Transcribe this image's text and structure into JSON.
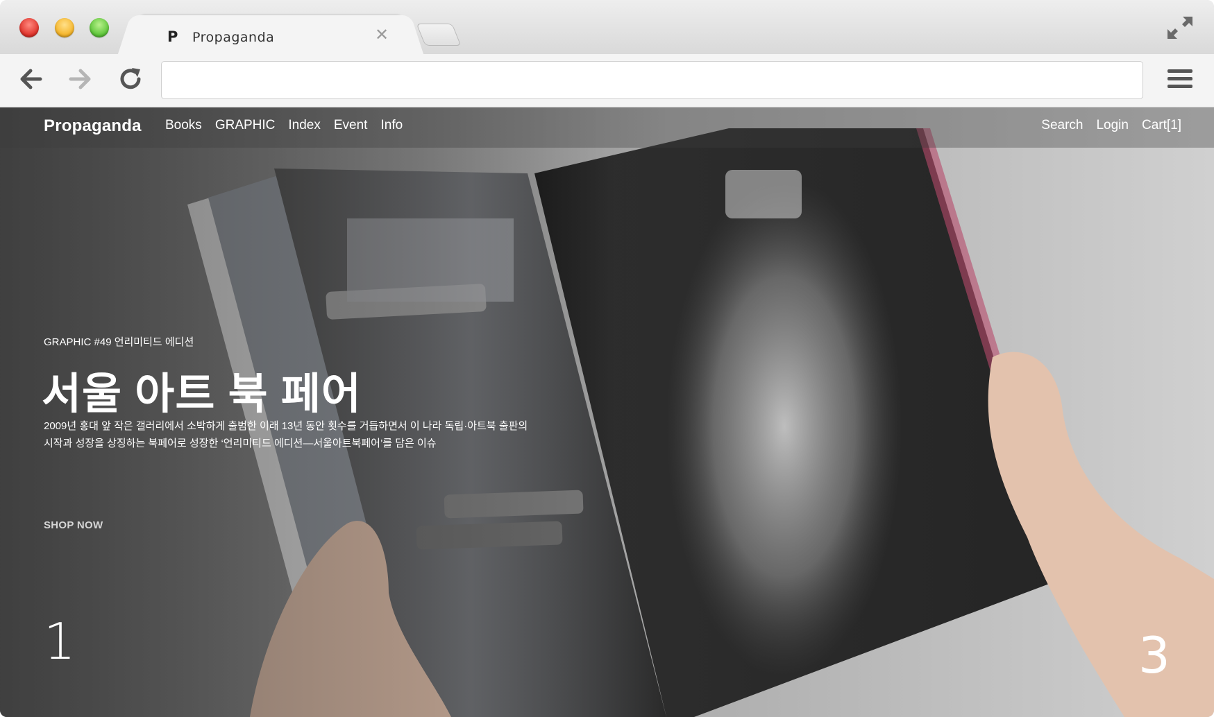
{
  "browser": {
    "tab": {
      "favicon": "P",
      "title": "Propaganda",
      "close": "✕"
    },
    "url": "",
    "icons": [
      "back-arrow-icon",
      "forward-arrow-icon",
      "reload-icon",
      "hamburger-menu-icon",
      "fullscreen-icon",
      "close-icon"
    ]
  },
  "site": {
    "logo": "Propaganda",
    "nav": [
      "Books",
      "GRAPHIC",
      "Index",
      "Event",
      "Info"
    ],
    "utility": [
      "Search",
      "Login",
      "Cart[1]"
    ]
  },
  "hero": {
    "kicker": "GRAPHIC #49 언리미티드 에디션",
    "title": "서울 아트 북 페어",
    "description_line1": "2009년 홍대 앞 작은 갤러리에서 소박하게 출범한 이래 13년 동안 횟수를 거듭하면서 이 나라 독립·아트북 출판의",
    "description_line2": "시작과 성장을 상징하는 북페어로 성장한 ‘언리미티드 에디션—서울아트북페어’를 담은 이슈",
    "cta": "SHOP NOW",
    "slide_current": "1",
    "slide_total": "3"
  },
  "colors": {
    "traffic_close": "#e0342c",
    "traffic_minimize": "#f5b52a",
    "traffic_maximize": "#5ec63a",
    "site_text": "#ffffff"
  }
}
